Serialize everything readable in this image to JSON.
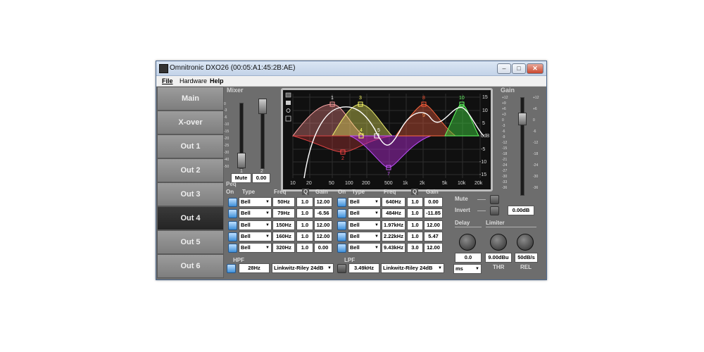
{
  "window": {
    "title": "Omnitronic DXO26 (00:05:A1:45:2B:AE)",
    "minimize": "–",
    "maximize": "□",
    "close": "✕"
  },
  "menu": [
    "File",
    "Hardware",
    "Help"
  ],
  "nav": [
    "Main",
    "X-over",
    "Out 1",
    "Out 2",
    "Out 3",
    "Out 4",
    "Out 5",
    "Out 6"
  ],
  "mixer": {
    "title": "Mixer",
    "ch1": "1",
    "ch2": "2",
    "mute": "Mute",
    "value": "0.00"
  },
  "peq": {
    "title": "Peq",
    "headers": {
      "on": "On",
      "type": "Type",
      "freq": "Freq",
      "q": "Q",
      "gain": "Gain"
    },
    "left": [
      {
        "type": "Bell",
        "freq": "50Hz",
        "q": "1.0",
        "gain": "12.00"
      },
      {
        "type": "Bell",
        "freq": "79Hz",
        "q": "1.0",
        "gain": "-6.56"
      },
      {
        "type": "Bell",
        "freq": "150Hz",
        "q": "1.0",
        "gain": "12.00"
      },
      {
        "type": "Bell",
        "freq": "160Hz",
        "q": "1.0",
        "gain": "12.00"
      },
      {
        "type": "Bell",
        "freq": "320Hz",
        "q": "1.0",
        "gain": "0.00"
      }
    ],
    "right": [
      {
        "type": "Bell",
        "freq": "640Hz",
        "q": "1.0",
        "gain": "0.00"
      },
      {
        "type": "Bell",
        "freq": "484Hz",
        "q": "1.0",
        "gain": "-11.85"
      },
      {
        "type": "Bell",
        "freq": "1.97kHz",
        "q": "1.0",
        "gain": "12.00"
      },
      {
        "type": "Bell",
        "freq": "2.22kHz",
        "q": "1.0",
        "gain": "5.47"
      },
      {
        "type": "Bell",
        "freq": "9.43kHz",
        "q": "3.0",
        "gain": "12.00"
      }
    ]
  },
  "hpf": {
    "label": "HPF",
    "freq": "28Hz",
    "type": "Linkwitz-Riley 24dB"
  },
  "lpf": {
    "label": "LPF",
    "freq": "3.49kHz",
    "type": "Linkwitz-Riley 24dB"
  },
  "graph": {
    "x_ticks": [
      "10",
      "20",
      "50",
      "100",
      "200",
      "500",
      "1k",
      "2k",
      "5k",
      "10k",
      "20k"
    ],
    "y_ticks": [
      "15",
      "10",
      "5",
      "0dB",
      "-5",
      "-10",
      "-15"
    ],
    "markers": [
      "1",
      "2",
      "3",
      "4",
      "5",
      "7",
      "8",
      "9",
      "10"
    ]
  },
  "gain": {
    "title": "Gain",
    "scale": [
      "+12",
      "+9",
      "+6",
      "+3",
      "0",
      "-3",
      "-6",
      "-9",
      "-12",
      "-15",
      "-18",
      "-21",
      "-24",
      "-27",
      "-30",
      "-33",
      "-36"
    ],
    "mute": "Mute",
    "invert": "Invert",
    "value": "0.00dB"
  },
  "delay": {
    "title": "Delay",
    "value": "0.0",
    "unit": "ms"
  },
  "limiter": {
    "title": "Limiter",
    "thr_value": "9.00dBu",
    "rel_value": "50dB/s",
    "thr": "THR",
    "rel": "REL"
  },
  "mixer_scale": [
    "0",
    "-3",
    "-6",
    "-10",
    "-15",
    "-20",
    "-25",
    "-30",
    "-40",
    "-50"
  ],
  "colors": {
    "accent": "#3f8fd8",
    "panel": "#707070",
    "graph_bg": "#101010"
  }
}
